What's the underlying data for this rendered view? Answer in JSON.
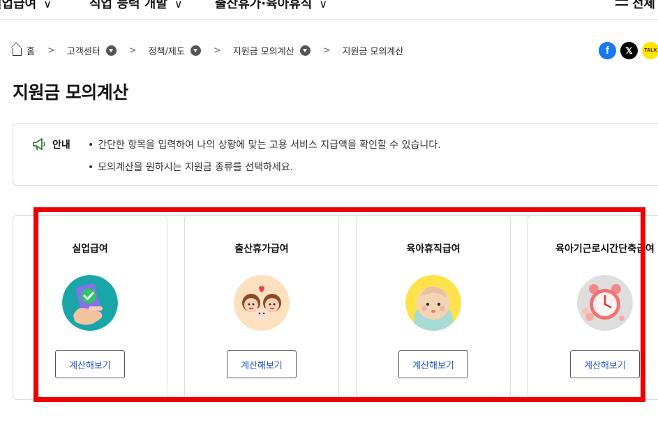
{
  "topnav": {
    "items": [
      {
        "label": "실업급여"
      },
      {
        "label": "직업 능력 개발"
      },
      {
        "label": "출산휴가·육아휴직"
      }
    ],
    "menu_label": "전체"
  },
  "breadcrumb": {
    "home": "홈",
    "items": [
      "고객센터",
      "정책/제도",
      "지원금 모의계산",
      "지원금 모의계산"
    ]
  },
  "share": {
    "facebook": "f",
    "x": "𝕏",
    "kakao": "TALK"
  },
  "page": {
    "title": "지원금 모의계산"
  },
  "notice": {
    "label": "안내",
    "lines": [
      "간단한 항목을 입력하여 나의 상황에 맞는 고용 서비스 지급액을 확인할 수 있습니다.",
      "모의계산을 원하시는 지원금 종류를 선택하세요."
    ]
  },
  "cards": [
    {
      "title": "실업급여",
      "button": "계산해보기",
      "icon": "phone-check-icon"
    },
    {
      "title": "출산휴가급여",
      "button": "계산해보기",
      "icon": "parents-baby-icon"
    },
    {
      "title": "육아휴직급여",
      "button": "계산해보기",
      "icon": "baby-face-icon"
    },
    {
      "title": "육아기근로시간단축급여",
      "button": "계산해보기",
      "icon": "alarm-clock-icon"
    }
  ],
  "colors": {
    "highlight": "#ee0000",
    "button_text": "#2255cc",
    "notice_icon": "#2e7d32"
  }
}
